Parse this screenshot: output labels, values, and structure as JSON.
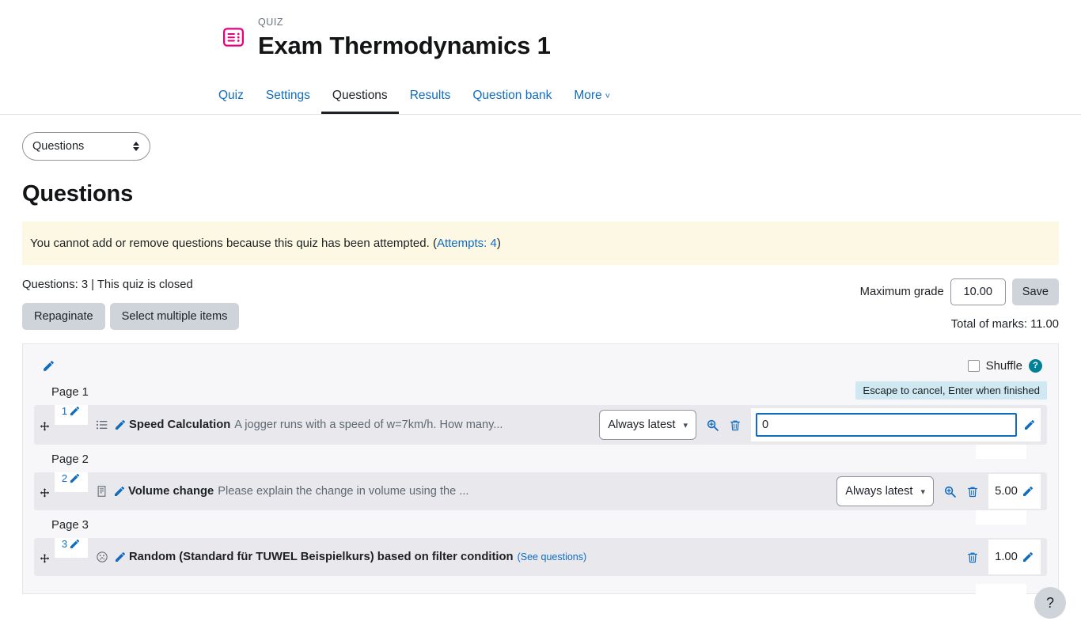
{
  "header": {
    "eyebrow": "QUIZ",
    "title": "Exam Thermodynamics 1",
    "icon": "quiz-icon",
    "icon_color": "#e6007e"
  },
  "tabs": [
    {
      "label": "Quiz",
      "active": false
    },
    {
      "label": "Settings",
      "active": false
    },
    {
      "label": "Questions",
      "active": true
    },
    {
      "label": "Results",
      "active": false
    },
    {
      "label": "Question bank",
      "active": false
    },
    {
      "label": "More",
      "active": false,
      "chevron": "˅"
    }
  ],
  "jump_select": {
    "value": "Questions"
  },
  "section_title": "Questions",
  "notice": {
    "text_before": "You cannot add or remove questions because this quiz has been attempted. (",
    "link": "Attempts: 4",
    "text_after": ")"
  },
  "status": {
    "summary": "Questions: 3 | This quiz is closed",
    "repaginate_label": "Repaginate",
    "select_multiple_label": "Select multiple items"
  },
  "grade": {
    "label": "Maximum grade",
    "value": "10.00",
    "save_label": "Save",
    "total_marks": "Total of marks: 11.00"
  },
  "list_header": {
    "shuffle_label": "Shuffle",
    "shuffle_checked": false,
    "help_glyph": "?"
  },
  "tooltip": {
    "text": "Escape to cancel, Enter when finished"
  },
  "pages": [
    {
      "label": "Page 1"
    },
    {
      "label": "Page 2"
    },
    {
      "label": "Page 3"
    }
  ],
  "questions": [
    {
      "number": "1",
      "type_icon": "multichoice-icon",
      "name": "Speed Calculation",
      "description": "A jogger runs with a speed of w=7km/h. How many...",
      "see_questions": "",
      "version": "Always latest",
      "has_version_select": true,
      "has_preview": true,
      "has_delete": true,
      "mark": "0",
      "editing": true
    },
    {
      "number": "2",
      "type_icon": "essay-icon",
      "name": "Volume change",
      "description": "Please explain the change in volume using the ...",
      "see_questions": "",
      "version": "Always latest",
      "has_version_select": true,
      "has_preview": true,
      "has_delete": true,
      "mark": "5.00",
      "editing": false
    },
    {
      "number": "3",
      "type_icon": "random-icon",
      "name": "Random (Standard für TUWEL Beispielkurs) based on filter condition",
      "description": "",
      "see_questions": "(See questions)",
      "version": "",
      "has_version_select": false,
      "has_preview": false,
      "has_delete": true,
      "mark": "1.00",
      "editing": false
    }
  ],
  "delete_page_marker": "✕",
  "help_fab": {
    "glyph": "?"
  },
  "colors": {
    "link": "#0f6cbf",
    "notice_bg": "#fcf8e3",
    "tooltip_bg": "#cfe8f2",
    "row_bg": "#e9e9ed",
    "panel_bg": "#f7f7f9",
    "help_teal": "#008196"
  }
}
